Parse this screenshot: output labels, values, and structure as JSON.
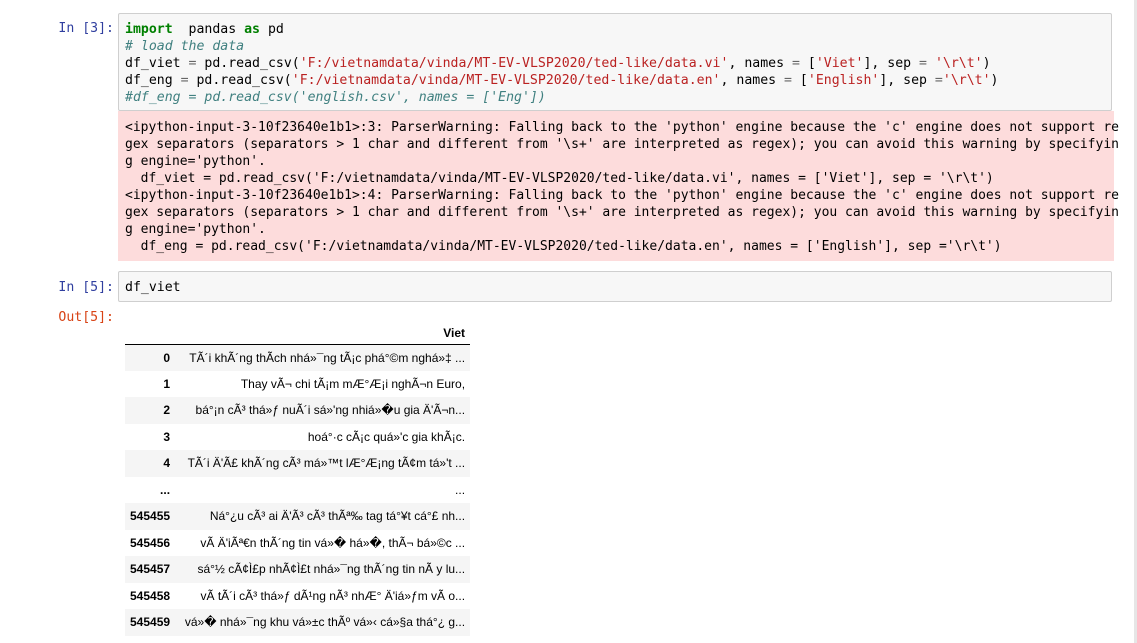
{
  "cell3": {
    "prompt": "In [3]:",
    "code_lines": [
      [
        [
          "kw",
          "import"
        ],
        [
          "",
          "  pandas "
        ],
        [
          "kw",
          "as"
        ],
        [
          "",
          " pd"
        ]
      ],
      [
        [
          "cmt",
          "# load the data"
        ]
      ],
      [
        [
          "",
          "df_viet "
        ],
        [
          "op",
          "="
        ],
        [
          "",
          " pd.read_csv("
        ],
        [
          "str",
          "'F:/vietnamdata/vinda/MT-EV-VLSP2020/ted-like/data.vi'"
        ],
        [
          "",
          ", names "
        ],
        [
          "op",
          "="
        ],
        [
          "",
          " ["
        ],
        [
          "str",
          "'Viet'"
        ],
        [
          "",
          "], sep "
        ],
        [
          "op",
          "="
        ],
        [
          "",
          " "
        ],
        [
          "str",
          "'\\r\\t'"
        ],
        [
          "",
          ")"
        ]
      ],
      [
        [
          "",
          "df_eng "
        ],
        [
          "op",
          "="
        ],
        [
          "",
          " pd.read_csv("
        ],
        [
          "str",
          "'F:/vietnamdata/vinda/MT-EV-VLSP2020/ted-like/data.en'"
        ],
        [
          "",
          ", names "
        ],
        [
          "op",
          "="
        ],
        [
          "",
          " ["
        ],
        [
          "str",
          "'English'"
        ],
        [
          "",
          "], sep "
        ],
        [
          "op",
          "="
        ],
        [
          "str",
          "'\\r\\t'"
        ],
        [
          "",
          ")"
        ]
      ],
      [
        [
          "cmt",
          "#df_eng = pd.read_csv('english.csv', names = ['Eng'])"
        ]
      ]
    ],
    "stderr_lines": [
      "<ipython-input-3-10f23640e1b1>:3: ParserWarning: Falling back to the 'python' engine because the 'c' engine does not support re",
      "gex separators (separators > 1 char and different from '\\s+' are interpreted as regex); you can avoid this warning by specifyin",
      "g engine='python'.",
      "  df_viet = pd.read_csv('F:/vietnamdata/vinda/MT-EV-VLSP2020/ted-like/data.vi', names = ['Viet'], sep = '\\r\\t')",
      "<ipython-input-3-10f23640e1b1>:4: ParserWarning: Falling back to the 'python' engine because the 'c' engine does not support re",
      "gex separators (separators > 1 char and different from '\\s+' are interpreted as regex); you can avoid this warning by specifyin",
      "g engine='python'.",
      "  df_eng = pd.read_csv('F:/vietnamdata/vinda/MT-EV-VLSP2020/ted-like/data.en', names = ['English'], sep ='\\r\\t')"
    ]
  },
  "cell5": {
    "in_prompt": "In [5]:",
    "code": "df_viet",
    "out_prompt": "Out[5]:",
    "table": {
      "column": "Viet",
      "rows": [
        {
          "index": "0",
          "value": "TÃ´i khÃ´ng thÃch nhá»¯ng tÃ¡c phá°©m nghá»‡ ..."
        },
        {
          "index": "1",
          "value": "Thay vÃ¬ chi tÃ¡m mÆ°Æ¡i nghÃ¬n Euro,"
        },
        {
          "index": "2",
          "value": "bá°¡n cÃ³ thá»ƒ nuÃ´i sá»'ng nhiá»�u gia Ä'Ã¬n..."
        },
        {
          "index": "3",
          "value": "hoá°·c cÃ¡c quá»'c gia khÃ¡c."
        },
        {
          "index": "4",
          "value": "TÃ´i Ä'Ã£ khÃ´ng cÃ³ má»™t lÆ°Æ¡ng tÃ¢m tá»'t ..."
        },
        {
          "index": "...",
          "value": "..."
        },
        {
          "index": "545455",
          "value": "Ná°¿u cÃ³ ai Ä'Ã³ cÃ³ thÃª‰ tag tá°¥t cá°£ nh..."
        },
        {
          "index": "545456",
          "value": "vÃ  Ä'iÃª€n thÃ´ng tin vá»� há»�, thÃ¬ bá»©c ..."
        },
        {
          "index": "545457",
          "value": "sá°½ cÃ¢Ì£p nhÃ¢Ì£t nhá»¯ng thÃ´ng tin nÃ y lu..."
        },
        {
          "index": "545458",
          "value": "vÃ  tÃ´i cÃ³ thá»ƒ dÃ¹ng nÃ³ nhÆ° Ä'iá»ƒm vÃ o..."
        },
        {
          "index": "545459",
          "value": "vá»� nhá»¯ng khu vá»±c thÃº vá»‹ cá»§a thá°¿ g..."
        }
      ]
    }
  }
}
